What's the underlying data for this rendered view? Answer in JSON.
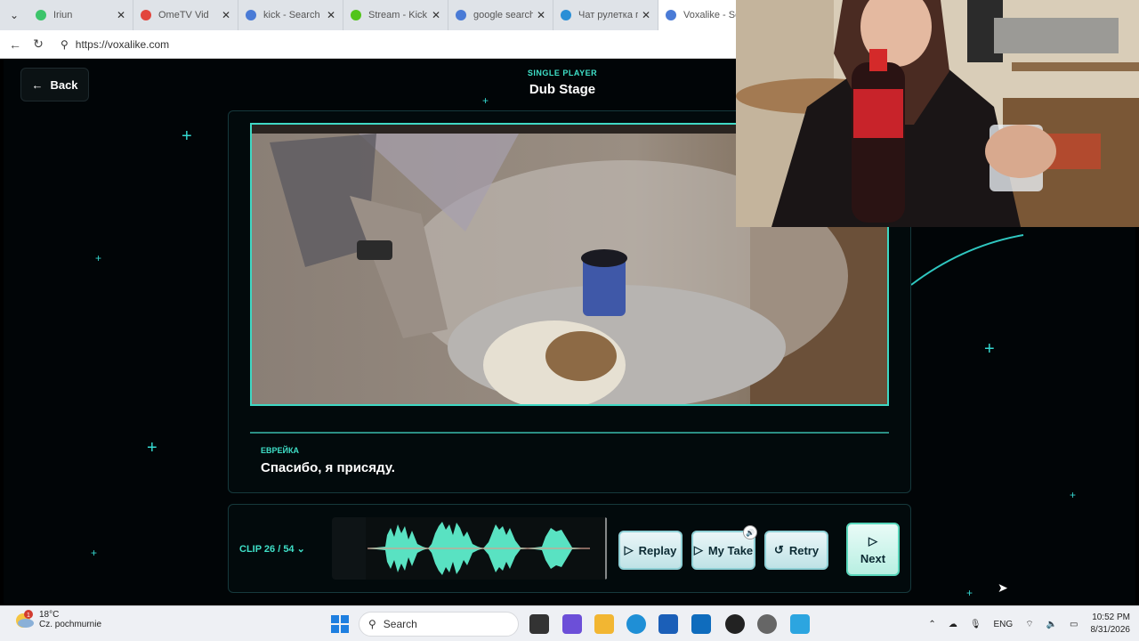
{
  "browser": {
    "tabs": [
      {
        "title": "Iriun",
        "color": "#3cc46a"
      },
      {
        "title": "OmeTV Vid",
        "color": "#e2453c"
      },
      {
        "title": "kick - Search",
        "color": "#4a7bd6"
      },
      {
        "title": "Stream - Kick D",
        "color": "#52c41a"
      },
      {
        "title": "google search",
        "color": "#4a7bd6"
      },
      {
        "title": "Чат рулетка го",
        "color": "#2a8fd6"
      },
      {
        "title": "Voxalike - Se",
        "color": "#4a7bd6"
      }
    ],
    "url": "https://voxalike.com"
  },
  "app": {
    "back_label": "Back",
    "mode_label": "SINGLE PLAYER",
    "stage_title": "Dub Stage",
    "speaker": "ЕВРЕЙКА",
    "line": "Спасибо, я присяду.",
    "clip_label": "CLIP 26 / 54",
    "buttons": {
      "replay": "Replay",
      "my_take": "My Take",
      "retry": "Retry",
      "next": "Next"
    },
    "accent": "#3fe0c8"
  },
  "taskbar": {
    "temp": "18°C",
    "weather": "Cz. pochmurnie",
    "notif_count": "1",
    "search": "Search",
    "lang": "ENG",
    "time": "10:52 PM",
    "date": "8/31/2026"
  }
}
